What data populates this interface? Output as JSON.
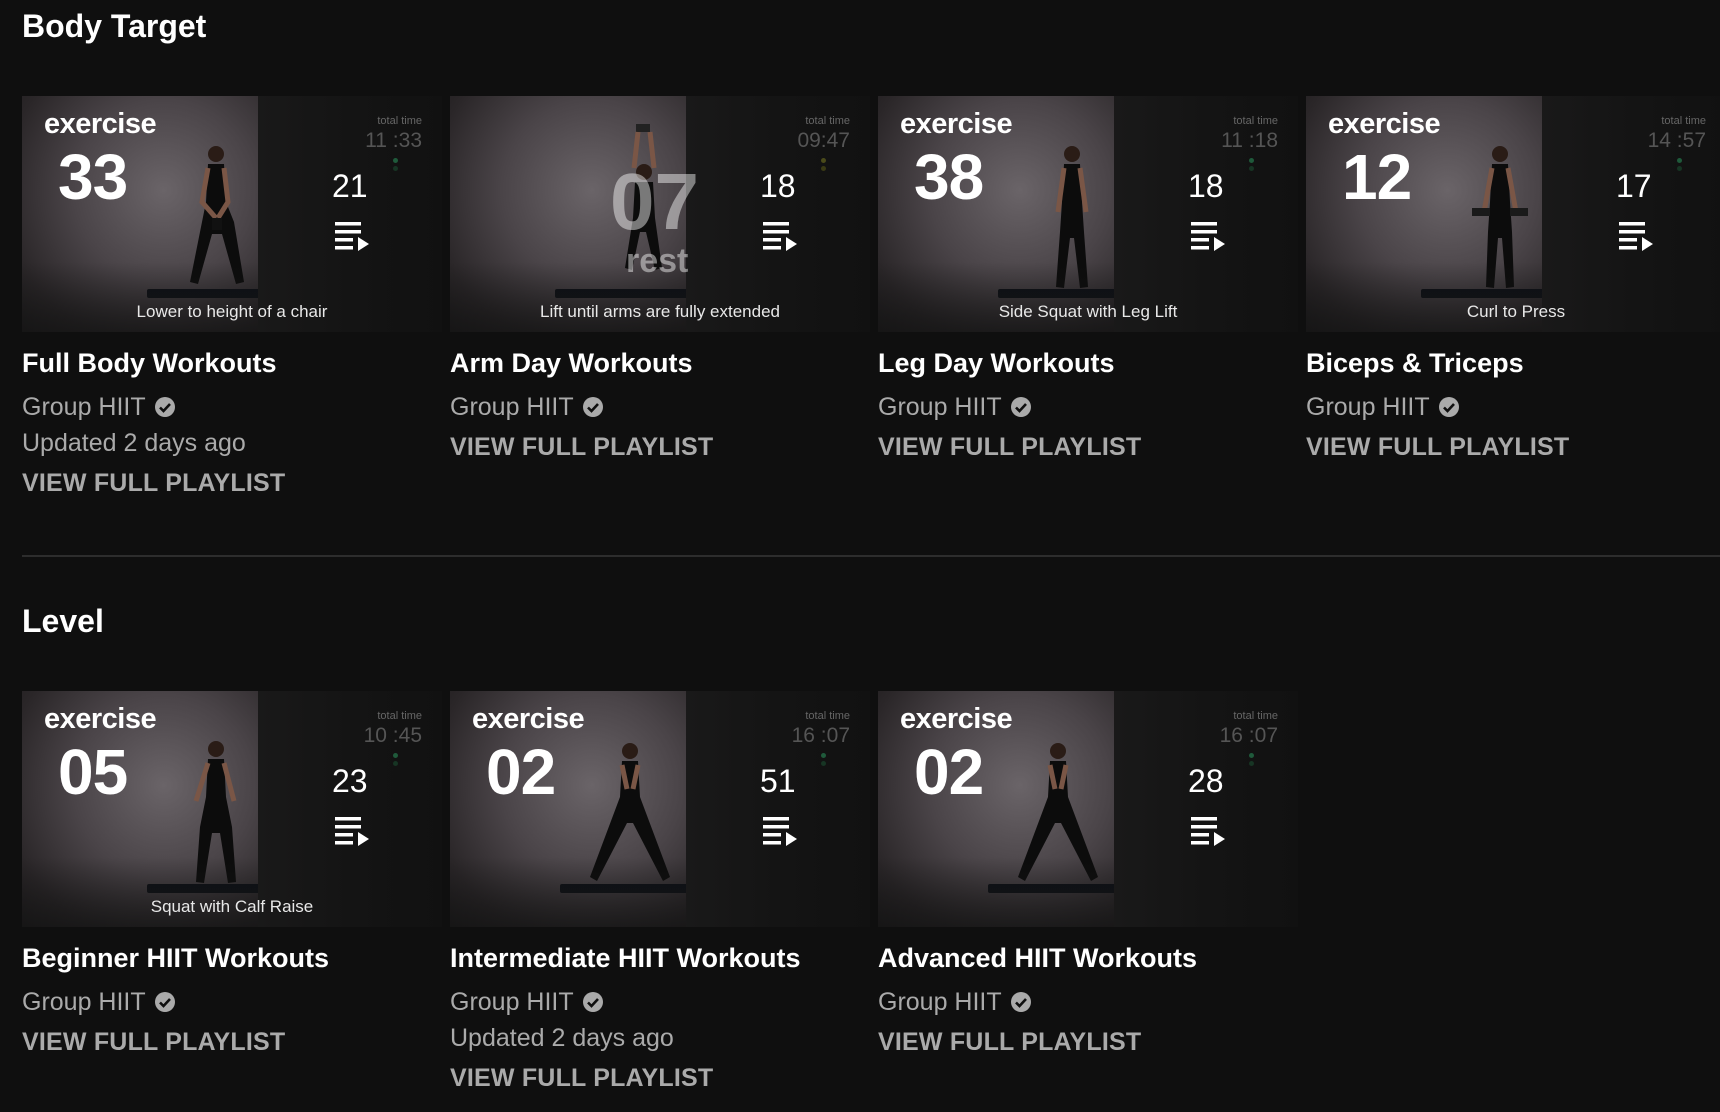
{
  "sections": [
    {
      "title": "Body Target",
      "playlists": [
        {
          "title": "Full Body Workouts",
          "channel": "Group HIIT",
          "updated": "Updated 2 days ago",
          "link": "VIEW FULL PLAYLIST",
          "count": "21",
          "thumb": {
            "word": "exercise",
            "number": "33",
            "caption": "Lower to height of a chair",
            "total_label": "total time",
            "total": "11 :33"
          }
        },
        {
          "title": "Arm Day Workouts",
          "channel": "Group HIIT",
          "updated": "",
          "link": "VIEW FULL PLAYLIST",
          "count": "18",
          "thumb": {
            "word": "rest",
            "number": "07",
            "caption": "Lift until arms are fully extended",
            "total_label": "total time",
            "total": "09:47"
          }
        },
        {
          "title": "Leg Day Workouts",
          "channel": "Group HIIT",
          "updated": "",
          "link": "VIEW FULL PLAYLIST",
          "count": "18",
          "thumb": {
            "word": "exercise",
            "number": "38",
            "caption": "Side Squat with Leg Lift",
            "total_label": "total time",
            "total": "11 :18"
          }
        },
        {
          "title": "Biceps & Triceps",
          "channel": "Group HIIT",
          "updated": "",
          "link": "VIEW FULL PLAYLIST",
          "count": "17",
          "thumb": {
            "word": "exercise",
            "number": "12",
            "caption": "Curl to Press",
            "total_label": "total time",
            "total": "14 :57"
          }
        }
      ]
    },
    {
      "title": "Level",
      "playlists": [
        {
          "title": "Beginner HIIT Workouts",
          "channel": "Group HIIT",
          "updated": "",
          "link": "VIEW FULL PLAYLIST",
          "count": "23",
          "thumb": {
            "word": "exercise",
            "number": "05",
            "caption": "Squat with Calf Raise",
            "total_label": "total time",
            "total": "10 :45"
          }
        },
        {
          "title": "Intermediate HIIT Workouts",
          "channel": "Group HIIT",
          "updated": "Updated 2 days ago",
          "link": "VIEW FULL PLAYLIST",
          "count": "51",
          "thumb": {
            "word": "exercise",
            "number": "02",
            "caption": "",
            "total_label": "total time",
            "total": "16 :07"
          }
        },
        {
          "title": "Advanced HIIT Workouts",
          "channel": "Group HIIT",
          "updated": "",
          "link": "VIEW FULL PLAYLIST",
          "count": "28",
          "thumb": {
            "word": "exercise",
            "number": "02",
            "caption": "",
            "total_label": "total time",
            "total": "16 :07"
          }
        }
      ]
    }
  ],
  "icons": {
    "playlist": "playlist-play-icon",
    "verified": "verified-check-icon"
  },
  "colors": {
    "background": "#0f0f0f",
    "secondary_text": "#aaaaaa",
    "primary_text": "#ffffff"
  }
}
